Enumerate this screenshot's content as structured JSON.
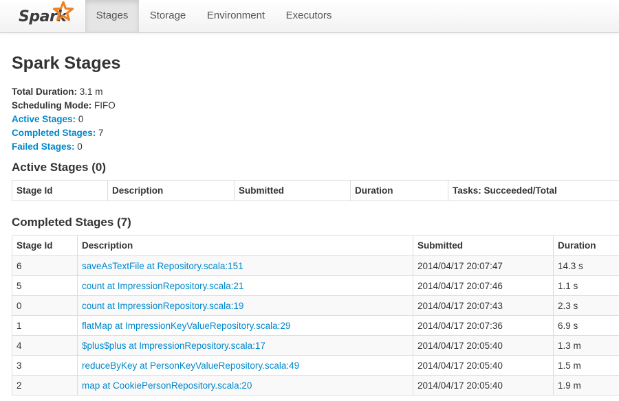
{
  "brand": {
    "name": "Spark"
  },
  "nav": {
    "tabs": [
      {
        "label": "Stages",
        "active": true
      },
      {
        "label": "Storage",
        "active": false
      },
      {
        "label": "Environment",
        "active": false
      },
      {
        "label": "Executors",
        "active": false
      }
    ]
  },
  "page": {
    "title": "Spark Stages"
  },
  "summary": {
    "total_duration_label": "Total Duration:",
    "total_duration_value": "3.1 m",
    "scheduling_mode_label": "Scheduling Mode:",
    "scheduling_mode_value": "FIFO",
    "active_stages_label": "Active Stages:",
    "active_stages_value": "0",
    "completed_stages_label": "Completed Stages:",
    "completed_stages_value": "7",
    "failed_stages_label": "Failed Stages:",
    "failed_stages_value": "0"
  },
  "active_section": {
    "heading": "Active Stages (0)",
    "columns": [
      "Stage Id",
      "Description",
      "Submitted",
      "Duration",
      "Tasks: Succeeded/Total"
    ]
  },
  "completed_section": {
    "heading": "Completed Stages (7)",
    "columns": [
      "Stage Id",
      "Description",
      "Submitted",
      "Duration"
    ],
    "rows": [
      {
        "id": "6",
        "description": "saveAsTextFile at Repository.scala:151",
        "submitted": "2014/04/17 20:07:47",
        "duration": "14.3 s"
      },
      {
        "id": "5",
        "description": "count at ImpressionRepository.scala:21",
        "submitted": "2014/04/17 20:07:46",
        "duration": "1.1 s"
      },
      {
        "id": "0",
        "description": "count at ImpressionRepository.scala:19",
        "submitted": "2014/04/17 20:07:43",
        "duration": "2.3 s"
      },
      {
        "id": "1",
        "description": "flatMap at ImpressionKeyValueRepository.scala:29",
        "submitted": "2014/04/17 20:07:36",
        "duration": "6.9 s"
      },
      {
        "id": "4",
        "description": "$plus$plus at ImpressionRepository.scala:17",
        "submitted": "2014/04/17 20:05:40",
        "duration": "1.3 m"
      },
      {
        "id": "3",
        "description": "reduceByKey at PersonKeyValueRepository.scala:49",
        "submitted": "2014/04/17 20:05:40",
        "duration": "1.5 m"
      },
      {
        "id": "2",
        "description": "map at CookiePersonRepository.scala:20",
        "submitted": "2014/04/17 20:05:40",
        "duration": "1.9 m"
      }
    ]
  },
  "colors": {
    "link": "#0088cc",
    "brand_star": "#f08020",
    "text": "#333333",
    "nav_active_bg": "#e5e5e5"
  }
}
